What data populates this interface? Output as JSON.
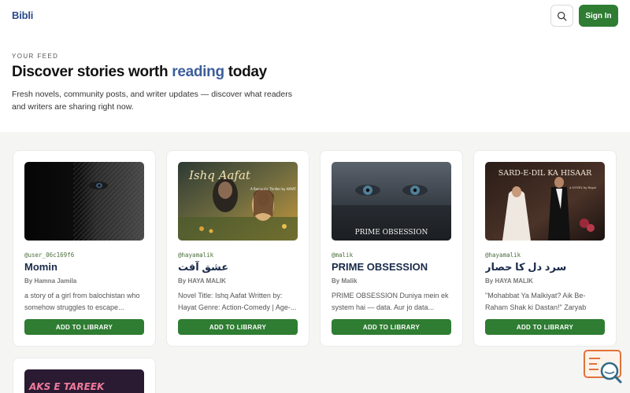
{
  "app": {
    "name": "Bibli"
  },
  "header": {
    "signin_label": "Sign In"
  },
  "hero": {
    "eyebrow": "YOUR FEED",
    "title_pre": "Discover stories worth ",
    "title_accent": "reading",
    "title_post": " today",
    "description": "Fresh novels, community posts, and writer updates — discover what readers and writers are sharing right now."
  },
  "cards": [
    {
      "handle": "@user_06c169f6",
      "title": "Momin",
      "author": "By Hamna Jamila",
      "blurb": "a story of a girl from balochistan who somehow struggles to escape...",
      "button": "ADD TO LIBRARY"
    },
    {
      "handle": "@hayamalik",
      "title": "عشق آفت",
      "author": "By HAYA MALIK",
      "blurb": "Novel Title: Ishq Aafat Written by: Hayat Genre: Action-Comedy | Age-...",
      "button": "ADD TO LIBRARY",
      "cover_text": "Ishq Aafat",
      "cover_sub": "A Romantic Thriller by HAYAT"
    },
    {
      "handle": "@malik",
      "title": "PRIME OBSESSION",
      "author": "By Malik",
      "blurb": "PRIME OBSESSION Duniya mein ek system hai — data. Aur jo data...",
      "button": "ADD TO LIBRARY",
      "cover_text": "PRIME OBSESSION"
    },
    {
      "handle": "@hayamalik",
      "title": "سرد دل کا حصار",
      "author": "By HAYA MALIK",
      "blurb": "\"Mohabbat Ya Malkiyat? Aik Be-Raham Shak ki Dastan!\" Zaryab Sha...",
      "button": "ADD TO LIBRARY",
      "cover_text": "SARD-E-DIL KA HISAAR",
      "cover_sub": "A NOVEL by Hayat"
    }
  ],
  "partial_card": {
    "cover_text": "AKS E TAREEK"
  },
  "icons": {
    "search": "search-icon",
    "floating": "chat-search-icon"
  },
  "colors": {
    "brand_blue": "#2b4a8b",
    "accent_blue": "#3b5f9a",
    "primary_green": "#2e7d32",
    "feed_bg": "#f5f5f4"
  }
}
